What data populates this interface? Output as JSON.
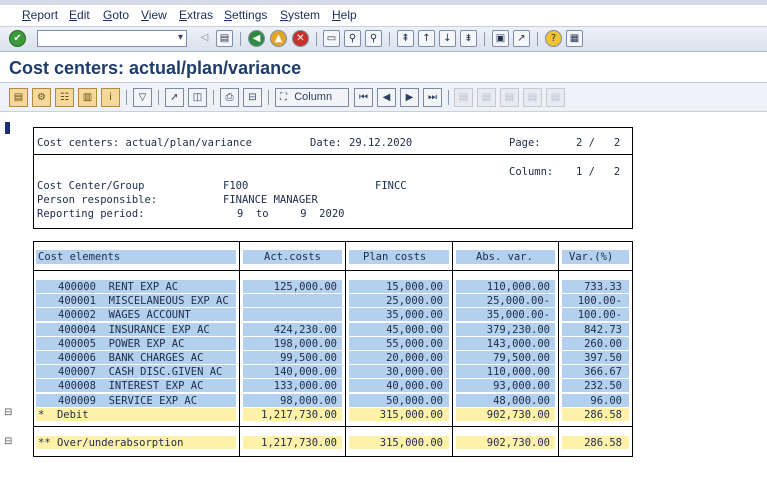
{
  "menu": [
    "Report",
    "Edit",
    "Goto",
    "View",
    "Extras",
    "Settings",
    "System",
    "Help"
  ],
  "title": "Cost centers: actual/plan/variance",
  "app_toolbar": {
    "column_label": "Column"
  },
  "report_header": {
    "title": "Cost centers: actual/plan/variance",
    "date_label": "Date:",
    "date_value": "29.12.2020",
    "page_label": "Page:",
    "page_value": "2 /   2",
    "column_label": "Column:",
    "column_value": "1 /   2",
    "cost_center_label": "Cost Center/Group",
    "cost_center_value": "F100",
    "cost_center_group": "FINCC",
    "person_label": "Person responsible:",
    "person_value": "FINANCE MANAGER",
    "period_label": "Reporting period:",
    "period_value": "9  to     9  2020"
  },
  "columns": [
    "Cost elements",
    "Act.costs",
    "Plan costs",
    "Abs. var.",
    "Var.(%)"
  ],
  "rows": [
    {
      "element": "400000  RENT EXP AC",
      "act": "125,000.00",
      "plan": "15,000.00",
      "abs": "110,000.00",
      "var": "733.33"
    },
    {
      "element": "400001  MISCELANEOUS EXP AC",
      "act": "",
      "plan": "25,000.00",
      "abs": "25,000.00-",
      "var": "100.00-"
    },
    {
      "element": "400002  WAGES ACCOUNT",
      "act": "",
      "plan": "35,000.00",
      "abs": "35,000.00-",
      "var": "100.00-"
    },
    {
      "element": "400004  INSURANCE EXP AC",
      "act": "424,230.00",
      "plan": "45,000.00",
      "abs": "379,230.00",
      "var": "842.73"
    },
    {
      "element": "400005  POWER EXP AC",
      "act": "198,000.00",
      "plan": "55,000.00",
      "abs": "143,000.00",
      "var": "260.00"
    },
    {
      "element": "400006  BANK CHARGES AC",
      "act": "99,500.00",
      "plan": "20,000.00",
      "abs": "79,500.00",
      "var": "397.50"
    },
    {
      "element": "400007  CASH DISC.GIVEN AC",
      "act": "140,000.00",
      "plan": "30,000.00",
      "abs": "110,000.00",
      "var": "366.67"
    },
    {
      "element": "400008  INTEREST EXP AC",
      "act": "133,000.00",
      "plan": "40,000.00",
      "abs": "93,000.00",
      "var": "232.50"
    },
    {
      "element": "400009  SERVICE EXP AC",
      "act": "98,000.00",
      "plan": "50,000.00",
      "abs": "48,000.00",
      "var": "96.00"
    }
  ],
  "debit_row": {
    "element": "*  Debit",
    "act": "1,217,730.00",
    "plan": "315,000.00",
    "abs": "902,730.00",
    "var": "286.58"
  },
  "overall_row": {
    "element": "** Over/underabsorption",
    "act": "1,217,730.00",
    "plan": "315,000.00",
    "abs": "902,730.00",
    "var": "286.58"
  },
  "colors": {
    "header_bg": "#b3d1ee",
    "total_bg": "#fff2a8",
    "title": "#1f3d6b"
  }
}
